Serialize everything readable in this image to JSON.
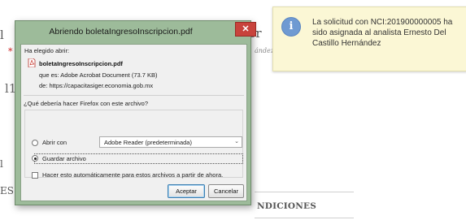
{
  "background": {
    "frag_left": "l",
    "frag_star": "*",
    "frag_i": "l1",
    "frag_bl": "ES",
    "frag_bl2": "l",
    "frag_cr": "cr",
    "city_text": "ández (Ciudad de México)",
    "conditions_fragment": "NDICIONES"
  },
  "notification": {
    "icon": "info-icon",
    "message": "La solicitud con NCI:201900000005 ha sido asignada al analista Ernesto Del Castillo Hernández"
  },
  "dialog": {
    "title": "Abriendo boletaIngresoInscripcion.pdf",
    "close_label": "✕",
    "chosen_label": "Ha elegido abrir:",
    "file_icon": "pdf-icon",
    "file_name": "boletaIngresoInscripcion.pdf",
    "file_type": "que es:  Adobe Acrobat Document (73.7 KB)",
    "file_source": "de:  https://capacitasiger.economia.gob.mx",
    "question": "¿Qué debería hacer Firefox con este archivo?",
    "open_with_label": "Abrir con",
    "open_with_app": "Adobe Reader  (predeterminada)",
    "save_label": "Guardar archivo",
    "auto_label": "Hacer esto automáticamente para estos archivos a partir de ahora.",
    "accept_label": "Aceptar",
    "cancel_label": "Cancelar",
    "selected_option": "save",
    "auto_checked": false
  },
  "colors": {
    "dialog_frame": "#9dbb9a",
    "close_button": "#c8433c",
    "notification_bg": "#fbf7d5",
    "info_icon": "#6f9ad2"
  }
}
